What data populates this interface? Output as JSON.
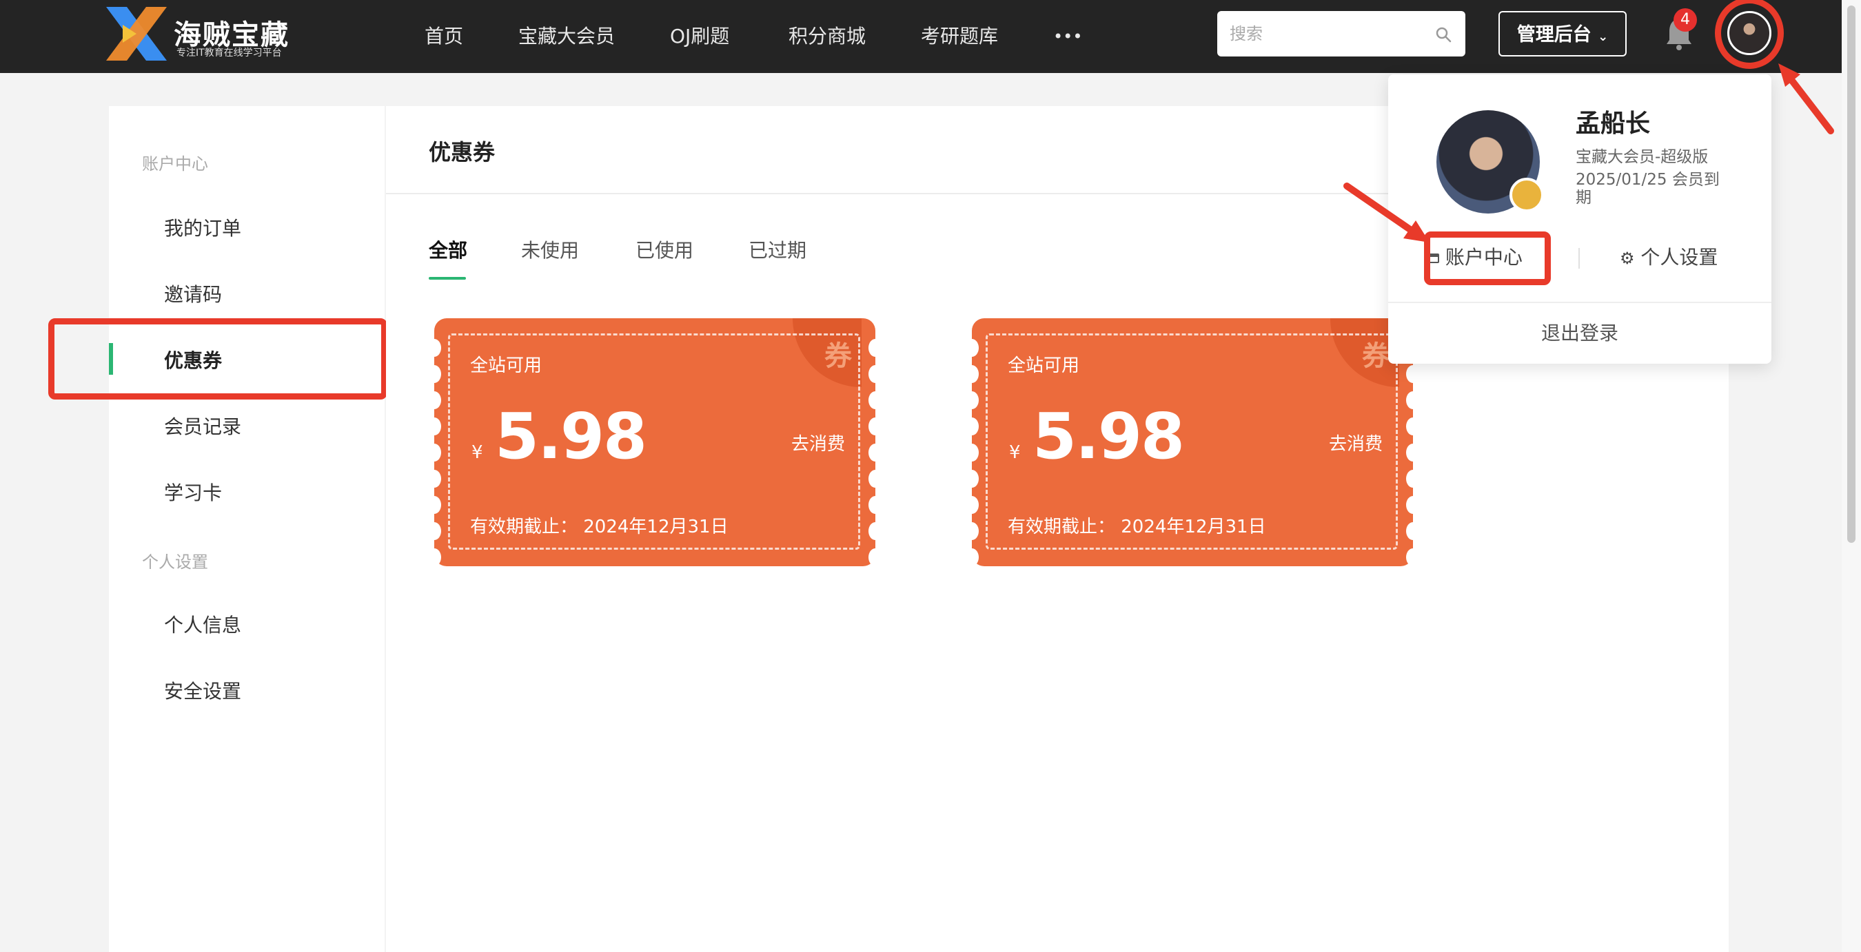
{
  "brand": {
    "title": "海贼宝藏",
    "subtitle": "专注IT教育在线学习平台"
  },
  "nav": {
    "items": [
      "首页",
      "宝藏大会员",
      "OJ刷题",
      "积分商城",
      "考研题库"
    ],
    "more": "•••"
  },
  "search": {
    "placeholder": "搜索"
  },
  "admin": {
    "label": "管理后台"
  },
  "notifications": {
    "count": "4"
  },
  "sidebar": {
    "section1": "账户中心",
    "items1": [
      "我的订单",
      "邀请码",
      "优惠券",
      "会员记录",
      "学习卡"
    ],
    "section2": "个人设置",
    "items2": [
      "个人信息",
      "安全设置"
    ],
    "active": "优惠券"
  },
  "content": {
    "title": "优惠券",
    "tabs": [
      "全部",
      "未使用",
      "已使用",
      "已过期"
    ],
    "active_tab": "全部"
  },
  "coupons": [
    {
      "scope": "全站可用",
      "currency": "¥",
      "amount": "5.98",
      "action": "去消费",
      "corner": "券",
      "expiry": "有效期截止：  2024年12月31日"
    },
    {
      "scope": "全站可用",
      "currency": "¥",
      "amount": "5.98",
      "action": "去消费",
      "corner": "券",
      "expiry": "有效期截止：  2024年12月31日"
    }
  ],
  "user_menu": {
    "name": "孟船长",
    "vip": "宝藏大会员-超级版",
    "expire": "2025/01/25 会员到期",
    "account_center": "账户中心",
    "settings": "个人设置",
    "logout": "退出登录"
  },
  "colors": {
    "accent": "#2bb673",
    "coupon": "#ec6b3c",
    "annotation": "#e83a2a",
    "topbar": "#242424"
  }
}
